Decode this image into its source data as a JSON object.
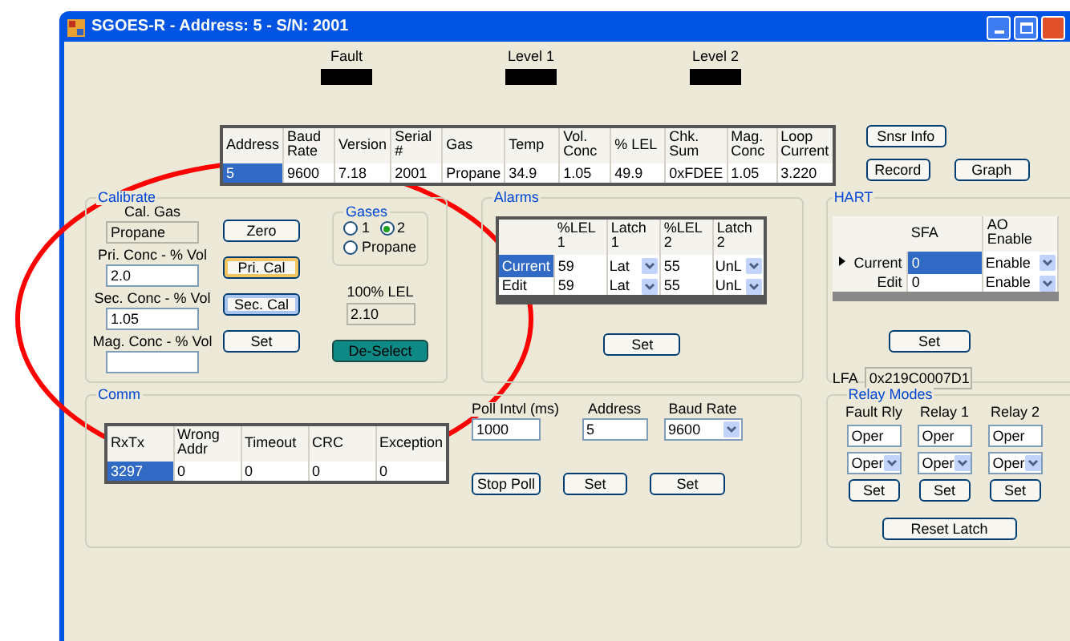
{
  "window": {
    "title": "SGOES-R - Address: 5 - S/N: 2001"
  },
  "indicators": [
    {
      "label": "Fault"
    },
    {
      "label": "Level 1"
    },
    {
      "label": "Level 2"
    }
  ],
  "info_table": {
    "columns": [
      "Address",
      "Baud Rate",
      "Version",
      "Serial #",
      "Gas",
      "Temp",
      "Vol. Conc",
      "% LEL",
      "Chk. Sum",
      "Mag. Conc",
      "Loop Current"
    ],
    "rows": [
      [
        {
          "text": "5",
          "selected": true
        },
        {
          "text": "9600",
          "selected": false
        },
        {
          "text": "7.18",
          "selected": false
        },
        {
          "text": "2001",
          "selected": false
        },
        {
          "text": "Propane",
          "selected": false
        },
        {
          "text": "34.9",
          "selected": false
        },
        {
          "text": "1.05",
          "selected": false
        },
        {
          "text": "49.9",
          "selected": false
        },
        {
          "text": "0xFDEE",
          "selected": false
        },
        {
          "text": "1.05",
          "selected": false
        },
        {
          "text": "3.220",
          "selected": false
        }
      ]
    ]
  },
  "top_buttons": [
    {
      "label": "Snsr Info"
    },
    {
      "label": "Record"
    },
    {
      "label": "Graph"
    }
  ],
  "calibrate": {
    "title": "Calibrate",
    "fields": [
      {
        "label": "Cal. Gas",
        "value": "Propane",
        "readonly": true
      },
      {
        "label": "Pri. Conc - % Vol",
        "value": "2.0",
        "readonly": false
      },
      {
        "label": "Sec. Conc - % Vol",
        "value": "1.05",
        "readonly": false
      },
      {
        "label": "Mag. Conc - % Vol",
        "readonly": false
      }
    ],
    "buttons": [
      {
        "label": "Zero",
        "hovered": false,
        "focused": false
      },
      {
        "label": "Pri. Cal",
        "hovered": true,
        "focused": false
      },
      {
        "label": "Sec. Cal",
        "hovered": false,
        "focused": true
      },
      {
        "label": "Set",
        "hovered": false,
        "focused": false
      }
    ],
    "gases": {
      "title": "Gases",
      "options": [
        {
          "label": "1",
          "selected": false
        },
        {
          "label": "2",
          "selected": true
        },
        {
          "label": "Propane",
          "selected": false
        }
      ]
    },
    "lel": {
      "label": "100% LEL",
      "value": "2.10"
    },
    "deselect": {
      "label": "De-Select"
    }
  },
  "alarms": {
    "title": "Alarms",
    "columns": [
      {
        "label": "%LEL 1",
        "kind": "text"
      },
      {
        "label": "Latch 1",
        "kind": "dropdown"
      },
      {
        "label": "%LEL 2",
        "kind": "text"
      },
      {
        "label": "Latch 2",
        "kind": "dropdown"
      }
    ],
    "rows": [
      {
        "header": "Current",
        "selected": true,
        "values": [
          "59",
          "Lat",
          "55",
          "UnL"
        ]
      },
      {
        "header": "Edit",
        "selected": false,
        "values": [
          "59",
          "Lat",
          "55",
          "UnL"
        ]
      }
    ],
    "button": "Set"
  },
  "hart": {
    "title": "HART",
    "columns": [
      {
        "label": "SFA",
        "kind": "text"
      },
      {
        "label": "AO Enable",
        "kind": "dropdown"
      }
    ],
    "rows": [
      {
        "header": "Current",
        "current": true,
        "cells": [
          {
            "text": "0",
            "selected": true
          },
          {
            "text": "Enable",
            "selected": false
          }
        ]
      },
      {
        "header": "Edit",
        "current": false,
        "cells": [
          {
            "text": "0",
            "selected": false
          },
          {
            "text": "Enable",
            "selected": false
          }
        ]
      }
    ],
    "button": "Set",
    "lfa_label": "LFA",
    "lfa_value": "0x219C0007D1"
  },
  "comm": {
    "title": "Comm",
    "columns": [
      "RxTx",
      "Wrong Addr",
      "Timeout",
      "CRC",
      "Exception"
    ],
    "rows": [
      [
        {
          "text": "3297",
          "selected": true
        },
        {
          "text": "0",
          "selected": false
        },
        {
          "text": "0",
          "selected": false
        },
        {
          "text": "0",
          "selected": false
        },
        {
          "text": "0",
          "selected": false
        }
      ]
    ],
    "poll_interval": {
      "label": "Poll Intvl (ms)",
      "value": "1000"
    },
    "address": {
      "label": "Address",
      "value": "5"
    },
    "baud_rate": {
      "label": "Baud Rate",
      "value": "9600"
    },
    "buttons": [
      "Stop Poll",
      "Set",
      "Set"
    ]
  },
  "relay_modes": {
    "title": "Relay Modes",
    "relays": [
      {
        "label": "Fault Rly",
        "value": "Oper",
        "mode": "Oper",
        "button": "Set"
      },
      {
        "label": "Relay 1",
        "value": "Oper",
        "mode": "Oper",
        "button": "Set"
      },
      {
        "label": "Relay 2",
        "value": "Oper",
        "mode": "Oper",
        "button": "Set"
      }
    ],
    "reset_button": "Reset Latch"
  }
}
